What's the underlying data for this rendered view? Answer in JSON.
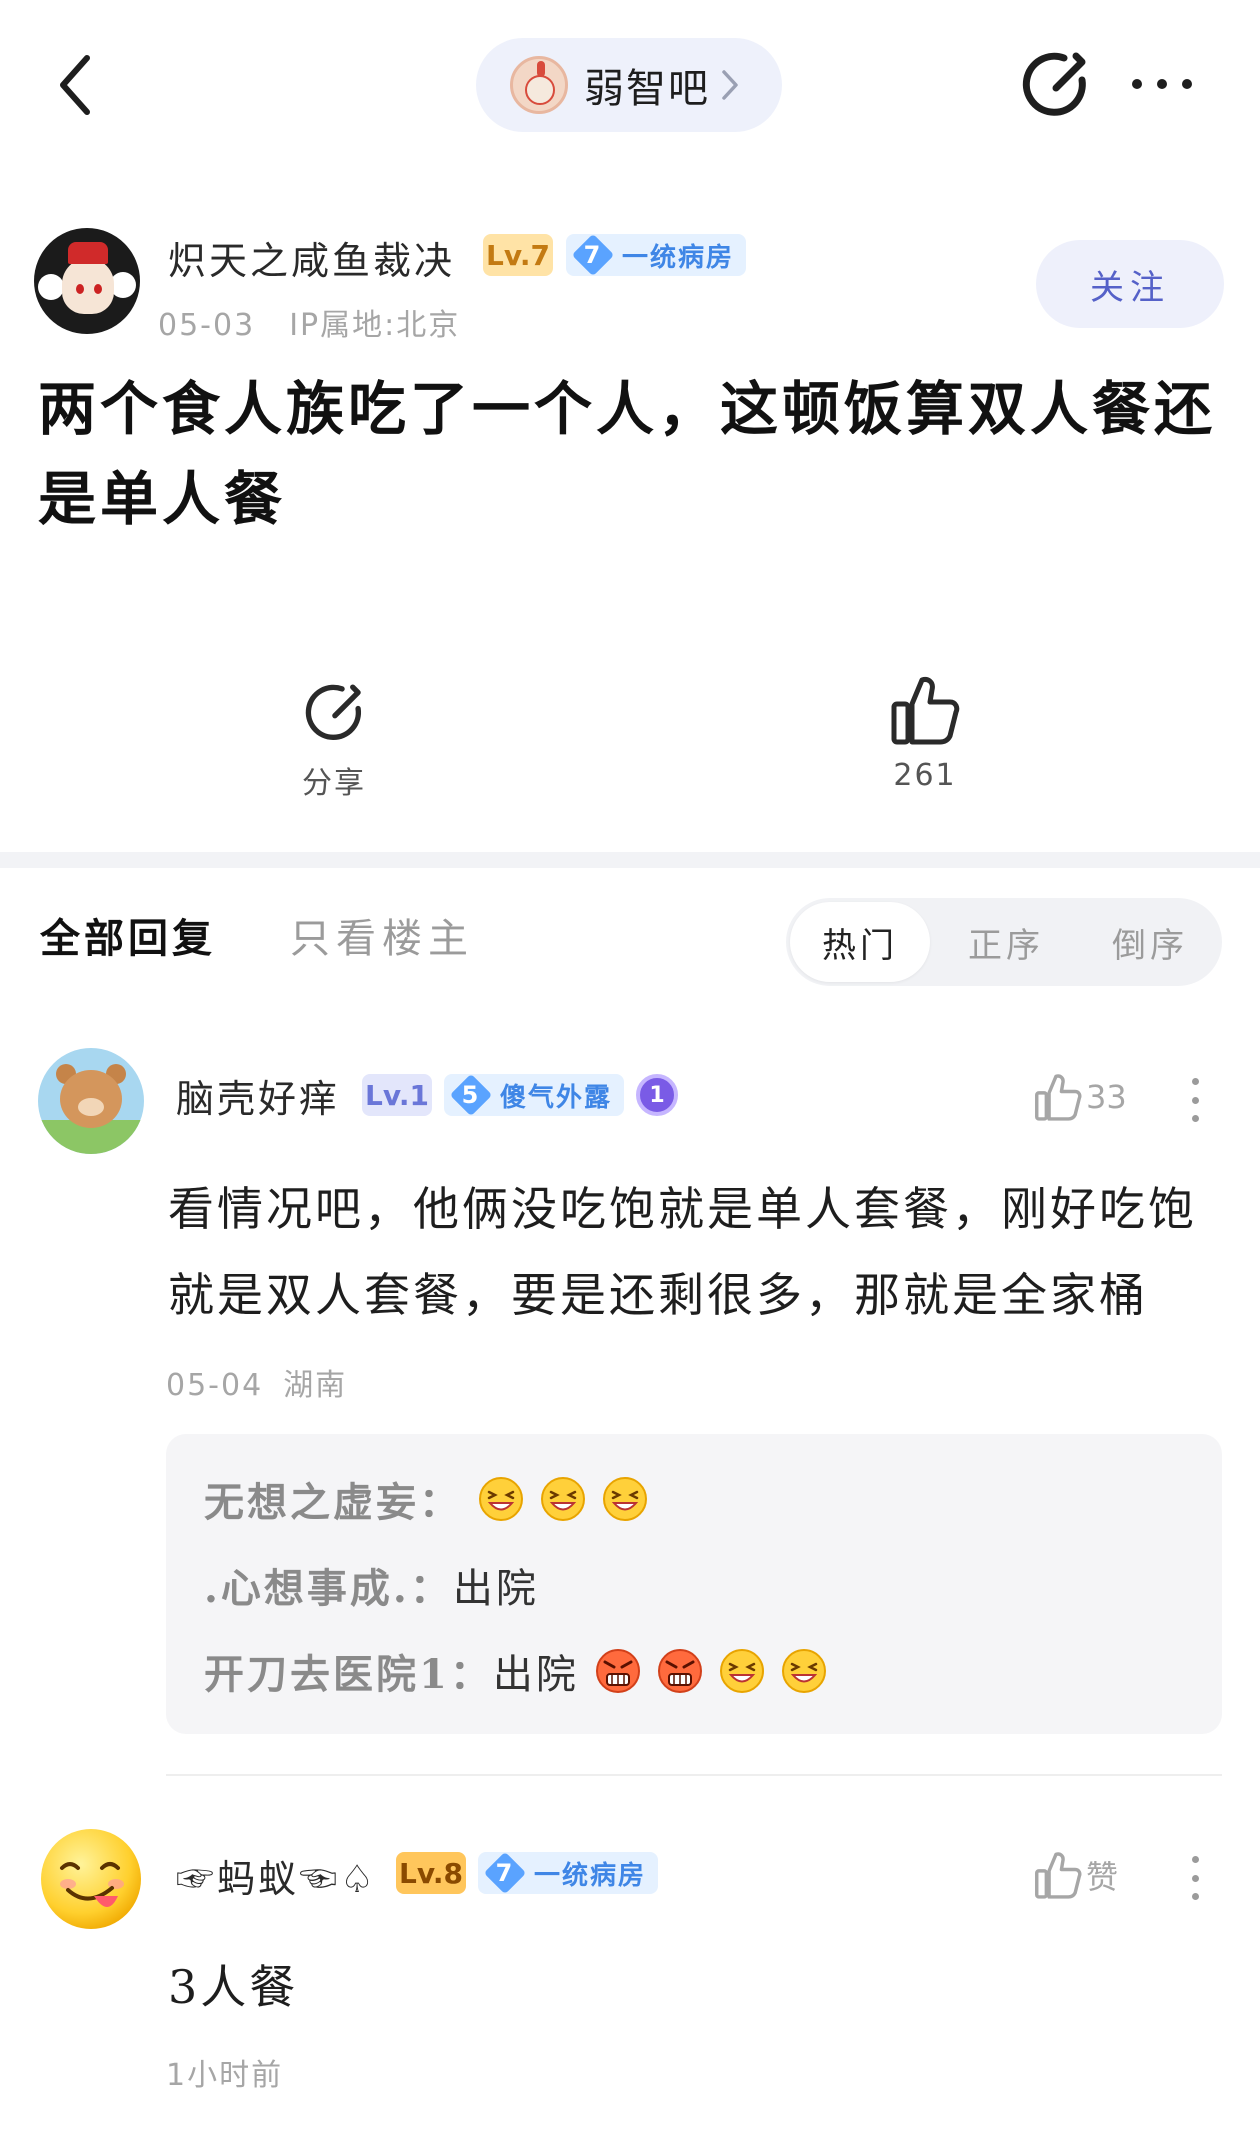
{
  "topbar": {
    "forum_name": "弱智吧",
    "icons": [
      "back-arrow-icon",
      "chevron-right-icon",
      "share-icon",
      "more-icon"
    ]
  },
  "post": {
    "author": "炽天之咸鱼裁决",
    "level": "Lv.7",
    "tag_number": "7",
    "tag_label": "一统病房",
    "date": "05-03",
    "ip": "IP属地:北京",
    "follow_label": "关注",
    "title": "两个食人族吃了一个人，这顿饭算双人餐还是单人餐",
    "share_label": "分享",
    "like_count": "261"
  },
  "tabs": {
    "all": "全部回复",
    "op_only": "只看楼主",
    "sort": [
      "热门",
      "正序",
      "倒序"
    ],
    "active_sort": "热门"
  },
  "comments": [
    {
      "author": "脑壳好痒",
      "level": "Lv.1",
      "tag_number": "5",
      "tag_label": "傻气外露",
      "medal": "1",
      "likes": "33",
      "text": "看情况吧，他俩没吃饱就是单人套餐，刚好吃饱就是双人套餐，要是还剩很多，那就是全家桶",
      "date": "05-04",
      "location": "湖南",
      "replies": [
        {
          "who": "无想之虚妄：",
          "text": "",
          "emojis": [
            "grin",
            "grin",
            "grin"
          ]
        },
        {
          "who": ".心想事成.：",
          "text": "出院",
          "emojis": []
        },
        {
          "who": "开刀去医院1：",
          "text": "出院",
          "emojis": [
            "angry",
            "angry",
            "grin",
            "grin"
          ]
        }
      ]
    },
    {
      "author": "☞蚂蚁☜♤",
      "level": "Lv.8",
      "tag_number": "7",
      "tag_label": "一统病房",
      "likes": "赞",
      "text": "3人餐",
      "time": "1小时前"
    }
  ],
  "colors": {
    "accent": "#5561c8",
    "tag_blue": "#3f86e6",
    "level_gold": "#c37a12",
    "muted": "#a6a6a6",
    "band": "#f2f3f6"
  }
}
